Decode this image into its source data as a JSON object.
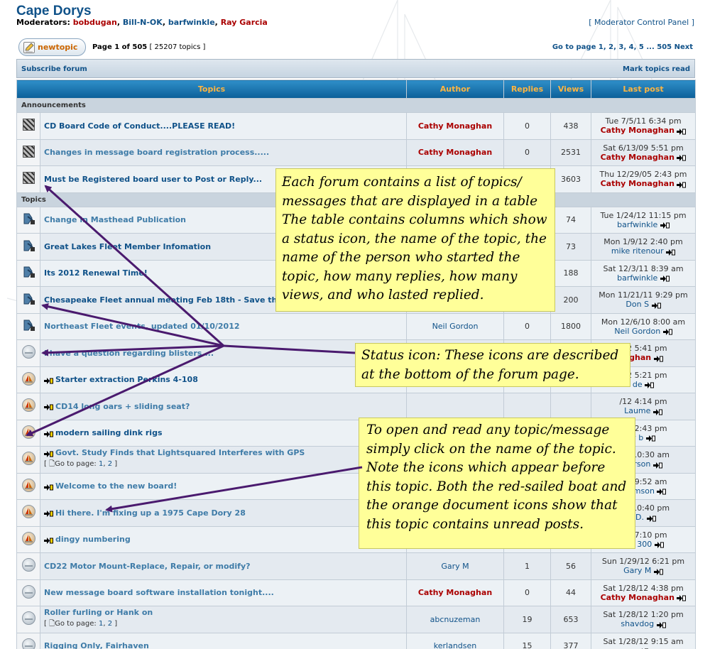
{
  "header": {
    "forum_title": "Cape Dorys",
    "moderators_label": "Moderators:",
    "moderators": [
      {
        "name": "bobdugan",
        "color": "#aa0000"
      },
      {
        "name": "Bill-N-OK",
        "color": "#105289"
      },
      {
        "name": "barfwinkle",
        "color": "#105289"
      },
      {
        "name": "Ray Garcia",
        "color": "#aa0000"
      }
    ],
    "mcp_link": "[ Moderator Control Panel ]"
  },
  "toolbar": {
    "new_topic_label": "newtopic",
    "page_label": "Page 1 of 505",
    "topic_count": "[ 25207 topics ]",
    "goto_label": "Go to page",
    "pages": [
      "1",
      "2",
      "3",
      "4",
      "5",
      "...",
      "505"
    ],
    "next_label": "Next"
  },
  "bar": {
    "subscribe": "Subscribe forum",
    "mark_read": "Mark topics read"
  },
  "table": {
    "columns": [
      "Topics",
      "Author",
      "Replies",
      "Views",
      "Last post"
    ],
    "announcements_label": "Announcements",
    "topics_label": "Topics",
    "announcements": [
      {
        "title": "CD Board Code of Conduct....PLEASE READ!",
        "read": false,
        "author": "Cathy Monaghan",
        "author_admin": true,
        "replies": "0",
        "views": "438",
        "last_date": "Tue 7/5/11 6:34 pm",
        "last_user": "Cathy Monaghan",
        "last_admin": true
      },
      {
        "title": "Changes in message board registration process.....",
        "read": true,
        "author": "Cathy Monaghan",
        "author_admin": true,
        "replies": "0",
        "views": "2531",
        "last_date": "Sat 6/13/09 5:51 pm",
        "last_user": "Cathy Monaghan",
        "last_admin": true
      },
      {
        "title": "Must be Registered board user to Post or Reply...",
        "read": false,
        "author": "",
        "author_admin": false,
        "replies": "",
        "views": "3603",
        "last_date": "Thu 12/29/05 2:43 pm",
        "last_user": "Cathy Monaghan",
        "last_admin": true
      }
    ],
    "topics": [
      {
        "icon": "hot",
        "newpost": false,
        "title": "Change in Masthead Publication",
        "read": true,
        "pages": null,
        "author": "",
        "author_admin": false,
        "replies": "",
        "views": "74",
        "last_date": "Tue 1/24/12 11:15 pm",
        "last_user": "barfwinkle",
        "last_admin": false
      },
      {
        "icon": "hot",
        "newpost": false,
        "title": "Great Lakes Fleet Member Infomation",
        "read": false,
        "pages": null,
        "author": "",
        "author_admin": false,
        "replies": "",
        "views": "73",
        "last_date": "Mon 1/9/12 2:40 pm",
        "last_user": "mike ritenour",
        "last_admin": false
      },
      {
        "icon": "hot",
        "newpost": false,
        "title": "Its 2012 Renewal Time!",
        "read": false,
        "pages": null,
        "author": "",
        "author_admin": false,
        "replies": "",
        "views": "188",
        "last_date": "Sat 12/3/11 8:39 am",
        "last_user": "barfwinkle",
        "last_admin": false
      },
      {
        "icon": "hot",
        "newpost": false,
        "title": "Chesapeake Fleet annual meeting Feb 18th - Save the Date!",
        "read": false,
        "pages": null,
        "author": "",
        "author_admin": false,
        "replies": "",
        "views": "200",
        "last_date": "Mon 11/21/11 9:29 pm",
        "last_user": "Don S",
        "last_admin": false
      },
      {
        "icon": "hot",
        "newpost": false,
        "title": "Northeast Fleet events, updated 01/10/2012",
        "read": true,
        "pages": null,
        "author": "Neil Gordon",
        "author_admin": false,
        "replies": "0",
        "views": "1800",
        "last_date": "Mon 12/6/10 8:00 am",
        "last_user": "Neil Gordon",
        "last_admin": false
      },
      {
        "icon": "plain",
        "newpost": false,
        "title": "I have a question regarding blisters....",
        "read": true,
        "pages": null,
        "author": "",
        "author_admin": false,
        "replies": "",
        "views": "",
        "last_date": "/12 5:41 pm",
        "last_user": "nghan",
        "last_admin": true
      },
      {
        "icon": "boat",
        "newpost": true,
        "title": "Starter extraction Perkins 4-108",
        "read": false,
        "pages": null,
        "author": "",
        "author_admin": false,
        "replies": "",
        "views": "",
        "last_date": "/12 5:21 pm",
        "last_user": "de",
        "last_admin": false
      },
      {
        "icon": "boat",
        "newpost": true,
        "title": "CD14 long oars + sliding seat?",
        "read": true,
        "pages": null,
        "author": "",
        "author_admin": false,
        "replies": "",
        "views": "",
        "last_date": "/12 4:14 pm",
        "last_user": "Laume",
        "last_admin": false
      },
      {
        "icon": "boat",
        "newpost": true,
        "title": "modern sailing dink rigs",
        "read": false,
        "pages": null,
        "author": "",
        "author_admin": false,
        "replies": "",
        "views": "",
        "last_date": "/12 2:43 pm",
        "last_user": "y b",
        "last_admin": false
      },
      {
        "icon": "boat",
        "newpost": true,
        "title": "Govt. Study Finds that Lightsquared Interferes with GPS",
        "read": true,
        "pages": [
          "1",
          "2"
        ],
        "author": "",
        "author_admin": false,
        "replies": "",
        "views": "",
        "last_date": "/12 10:30 am",
        "last_user": "yerson",
        "last_admin": false
      },
      {
        "icon": "boat",
        "newpost": true,
        "title": "Welcome to the new board!",
        "read": true,
        "pages": null,
        "author": "",
        "author_admin": false,
        "replies": "",
        "views": "",
        "last_date": "/12 9:52 am",
        "last_user": "bramson",
        "last_admin": false
      },
      {
        "icon": "boat",
        "newpost": true,
        "title": "Hi there. I'm fixing up a 1975 Cape Dory 28",
        "read": true,
        "pages": null,
        "author": "",
        "author_admin": false,
        "replies": "",
        "views": "",
        "last_date": "/12 10:40 pm",
        "last_user": "l D.",
        "last_admin": false
      },
      {
        "icon": "boat",
        "newpost": true,
        "title": "dingy numbering",
        "read": true,
        "pages": null,
        "author": "",
        "author_admin": false,
        "replies": "",
        "views": "",
        "last_date": "/12 7:10 pm",
        "last_user": "MS 300",
        "last_admin": false
      },
      {
        "icon": "plain",
        "newpost": false,
        "title": "CD22 Motor Mount-Replace, Repair, or modify?",
        "read": true,
        "pages": null,
        "author": "Gary M",
        "author_admin": false,
        "replies": "1",
        "views": "56",
        "last_date": "Sun 1/29/12 6:21 pm",
        "last_user": "Gary M",
        "last_admin": false
      },
      {
        "icon": "plain",
        "newpost": false,
        "title": "New message board software installation tonight....",
        "read": true,
        "pages": null,
        "author": "Cathy Monaghan",
        "author_admin": true,
        "replies": "0",
        "views": "44",
        "last_date": "Sat 1/28/12 4:38 pm",
        "last_user": "Cathy Monaghan",
        "last_admin": true
      },
      {
        "icon": "plain",
        "newpost": false,
        "title": "Roller furling or Hank on",
        "read": true,
        "pages": [
          "1",
          "2"
        ],
        "author": "abcnuzeman",
        "author_admin": false,
        "replies": "19",
        "views": "653",
        "last_date": "Sat 1/28/12 1:20 pm",
        "last_user": "shavdog",
        "last_admin": false
      },
      {
        "icon": "plain",
        "newpost": false,
        "title": "Rigging Only, Fairhaven",
        "read": true,
        "pages": null,
        "author": "kerlandsen",
        "author_admin": false,
        "replies": "15",
        "views": "377",
        "last_date": "Sat 1/28/12 9:15 am",
        "last_user": "",
        "last_admin": false
      }
    ],
    "goto_page_label": "Go to page:"
  },
  "notes": {
    "note1": "Each forum contains a list of topics/ messages that are displayed in a table The table contains columns which show a status icon, the name of the topic, the name of the person who started the topic, how many replies, how many views, and who lasted replied.",
    "note2": "Status icon:  These icons are described at the bottom of the forum page.",
    "note3": "To open and read any topic/message simply click on the name of the topic. Note the icons which appear before this topic. Both the red-sailed boat and the orange document icons show that this topic contains unread posts."
  },
  "colors": {
    "link": "#105289",
    "admin": "#aa0000",
    "header_text": "#ffb540",
    "note_bg": "#ffff99",
    "arrow": "#4a1a6e"
  }
}
